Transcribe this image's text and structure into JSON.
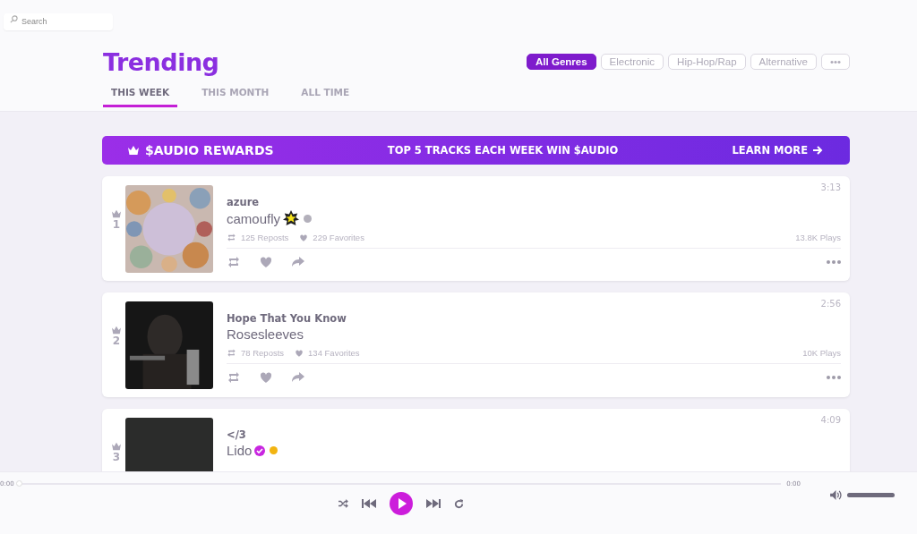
{
  "search": {
    "placeholder": "Search"
  },
  "header": {
    "title": "Trending",
    "tabs": [
      {
        "label": "THIS WEEK",
        "selected": true
      },
      {
        "label": "THIS MONTH",
        "selected": false
      },
      {
        "label": "ALL TIME",
        "selected": false
      }
    ],
    "genres": [
      {
        "label": "All Genres",
        "selected": true
      },
      {
        "label": "Electronic",
        "selected": false
      },
      {
        "label": "Hip-Hop/Rap",
        "selected": false
      },
      {
        "label": "Alternative",
        "selected": false
      },
      {
        "label": "•••",
        "selected": false
      }
    ]
  },
  "banner": {
    "title": "$AUDIO REWARDS",
    "message": "TOP 5 TRACKS EACH WEEK WIN $AUDIO",
    "link": "LEARN MORE"
  },
  "tracks": [
    {
      "rank": "1",
      "title": "azure",
      "artist": "camoufly",
      "badges": [
        {
          "kind": "star"
        },
        {
          "kind": "tier",
          "color": "#b3b0bb"
        }
      ],
      "duration": "3:13",
      "reposts": "125 Reposts",
      "favorites": "229 Favorites",
      "plays": "13.8K Plays"
    },
    {
      "rank": "2",
      "title": "Hope That You Know",
      "artist": "Rosesleeves",
      "duration": "2:56",
      "reposts": "78 Reposts",
      "favorites": "134 Favorites",
      "plays": "10K Plays"
    },
    {
      "rank": "3",
      "title": "</3",
      "artist": "Lido",
      "badges": [
        {
          "kind": "verified"
        },
        {
          "kind": "tier",
          "color": "#f2b411"
        }
      ],
      "duration": "4:09"
    }
  ],
  "player": {
    "elapsed": "0:00",
    "total": "0:00",
    "progress": {
      "level": 0
    },
    "volume": {
      "level": 1
    }
  }
}
